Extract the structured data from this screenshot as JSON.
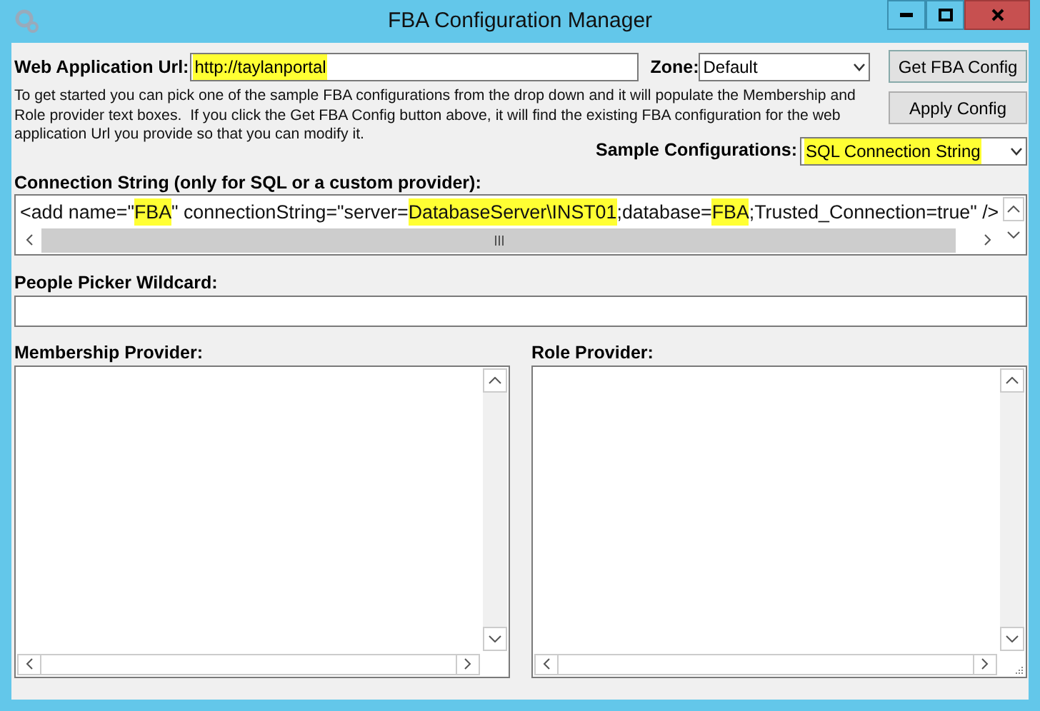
{
  "window": {
    "title": "FBA Configuration Manager"
  },
  "web_app_url": {
    "label": "Web Application Url:",
    "value": "http://taylanportal",
    "highlighted": true
  },
  "zone": {
    "label": "Zone:",
    "value": "Default"
  },
  "buttons": [
    {
      "label": "Get FBA Config"
    },
    {
      "label": "Apply Config"
    }
  ],
  "description": "To get started you can pick one of the sample FBA configurations from the drop down and it will populate the Membership and Role provider text boxes.  If you click the Get FBA Config button above, it will find the existing FBA configuration for the web application Url you provide so that you can modify it.",
  "sample_configurations": {
    "label": "Sample Configurations:",
    "value": "SQL Connection String",
    "highlighted": true
  },
  "connection_string": {
    "label": "Connection String (only for SQL or a custom provider):",
    "segments": [
      {
        "text": "<add name=\"",
        "highlighted": false
      },
      {
        "text": "FBA",
        "highlighted": true
      },
      {
        "text": "\" connectionString=\"server=",
        "highlighted": false
      },
      {
        "text": "DatabaseServer\\INST01",
        "highlighted": true
      },
      {
        "text": ";database=",
        "highlighted": false
      },
      {
        "text": "FBA",
        "highlighted": true
      },
      {
        "text": ";Trusted_Connection=true\" />",
        "highlighted": false
      }
    ]
  },
  "people_picker_wildcard": {
    "label": "People Picker Wildcard:"
  },
  "membership_provider": {
    "label": "Membership Provider:"
  },
  "role_provider": {
    "label": "Role Provider:"
  }
}
